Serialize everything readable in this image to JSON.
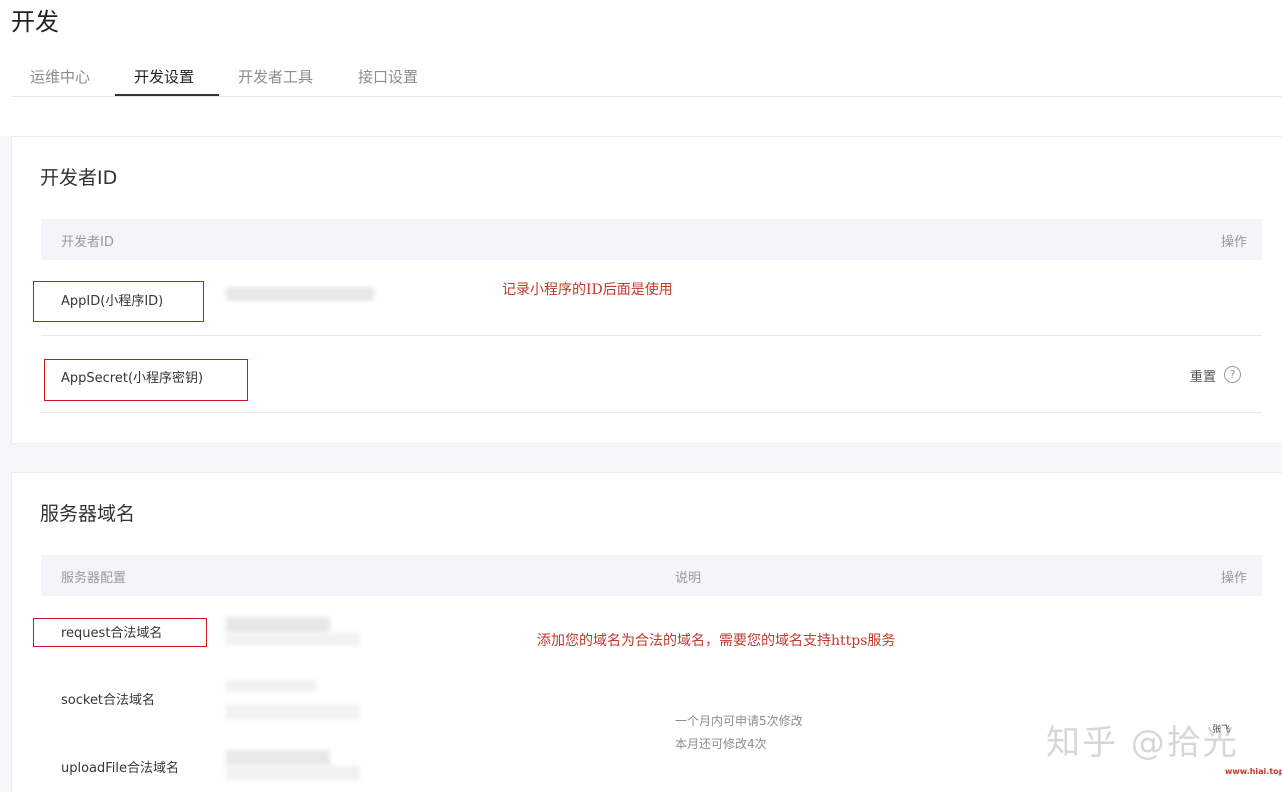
{
  "page": {
    "title": "开发"
  },
  "tabs": [
    {
      "label": "运维中心",
      "active": false
    },
    {
      "label": "开发设置",
      "active": true
    },
    {
      "label": "开发者工具",
      "active": false
    },
    {
      "label": "接口设置",
      "active": false
    }
  ],
  "developer_id": {
    "title": "开发者ID",
    "columns": {
      "name": "开发者ID",
      "action": "操作"
    },
    "rows": [
      {
        "label": "AppID(小程序ID)"
      },
      {
        "label": "AppSecret(小程序密钥)",
        "action": "重置"
      }
    ],
    "annotation": "记录小程序的ID后面是使用"
  },
  "server_domain": {
    "title": "服务器域名",
    "columns": {
      "config": "服务器配置",
      "desc": "说明",
      "action": "操作"
    },
    "rows": [
      {
        "label": "request合法域名"
      },
      {
        "label": "socket合法域名"
      },
      {
        "label": "uploadFile合法域名"
      }
    ],
    "annotation": "添加您的域名为合法的域名，需要您的域名支持https服务",
    "description_lines": [
      "一个月内可申请5次修改",
      "本月还可修改4次"
    ]
  },
  "watermark": {
    "main": "知乎 @拾光",
    "small": "张飞",
    "url": "www.hiai.top"
  },
  "colors": {
    "annotation_red": "#d0161c",
    "header_bg": "#f4f5f9",
    "page_bg": "#f5f6f7"
  }
}
